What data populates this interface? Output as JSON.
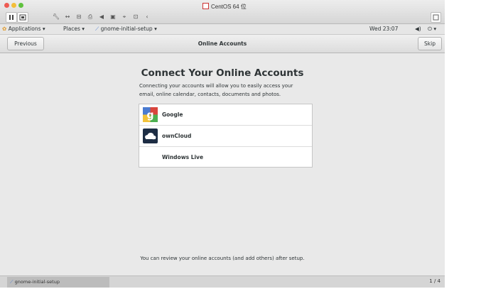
{
  "window": {
    "title": "CentOS 64 位"
  },
  "host_toolbar": {
    "pause_icon": "pause-icon",
    "snapshot_icon": "snapshot-icon",
    "tools": [
      "wrench-icon",
      "arrows-icon",
      "usb-icon",
      "printer-icon",
      "speaker-icon",
      "camera-icon",
      "network-icon",
      "disk-icon",
      "chevron-left-icon"
    ],
    "restore_icon": "restore-icon"
  },
  "gnome_panel": {
    "applications": "Applications",
    "places": "Places",
    "active_app": "gnome-initial-setup",
    "clock": "Wed 23:07"
  },
  "header": {
    "previous": "Previous",
    "title": "Online Accounts",
    "skip": "Skip"
  },
  "main": {
    "heading": "Connect Your Online Accounts",
    "description": "Connecting your accounts will allow you to easily access your email, online calendar, contacts, documents and photos.",
    "accounts": [
      {
        "label": "Google",
        "icon": "google-icon"
      },
      {
        "label": "ownCloud",
        "icon": "owncloud-icon"
      },
      {
        "label": "Windows Live",
        "icon": "windows-live-icon"
      }
    ],
    "footer_note": "You can review your online accounts (and add others) after setup."
  },
  "taskbar": {
    "item": "gnome-initial-setup",
    "pager": "1 / 4"
  },
  "colors": {
    "accent_green": "#4caf50",
    "google_blue": "#4a7bd1",
    "owncloud_navy": "#1d2d44"
  }
}
